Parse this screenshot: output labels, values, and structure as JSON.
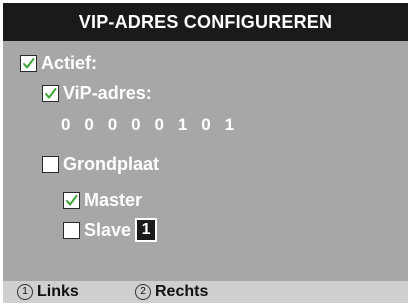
{
  "title": "VIP-ADRES CONFIGUREREN",
  "options": {
    "active": {
      "label": "Actief:",
      "checked": true
    },
    "vip_address": {
      "label": "ViP-adres:",
      "checked": true,
      "value": "0 0 0 0 0 1 0 1"
    },
    "floor_plan": {
      "label": "Grondplaat",
      "checked": false
    },
    "master": {
      "label": "Master",
      "checked": true
    },
    "slave": {
      "label": "Slave",
      "checked": false,
      "number": "1"
    }
  },
  "softkeys": [
    {
      "number": "1",
      "label": "Links"
    },
    {
      "number": "2",
      "label": "Rechts"
    }
  ],
  "icons": {
    "checked": "checkmark-icon",
    "unchecked": "empty-checkbox-icon"
  },
  "colors": {
    "background": "#a7a7a7",
    "title_bar": "#1a1a1a",
    "text": "#ffffff",
    "checkmark": "#3aa635",
    "softkey_bar": "#cfcfcf"
  }
}
